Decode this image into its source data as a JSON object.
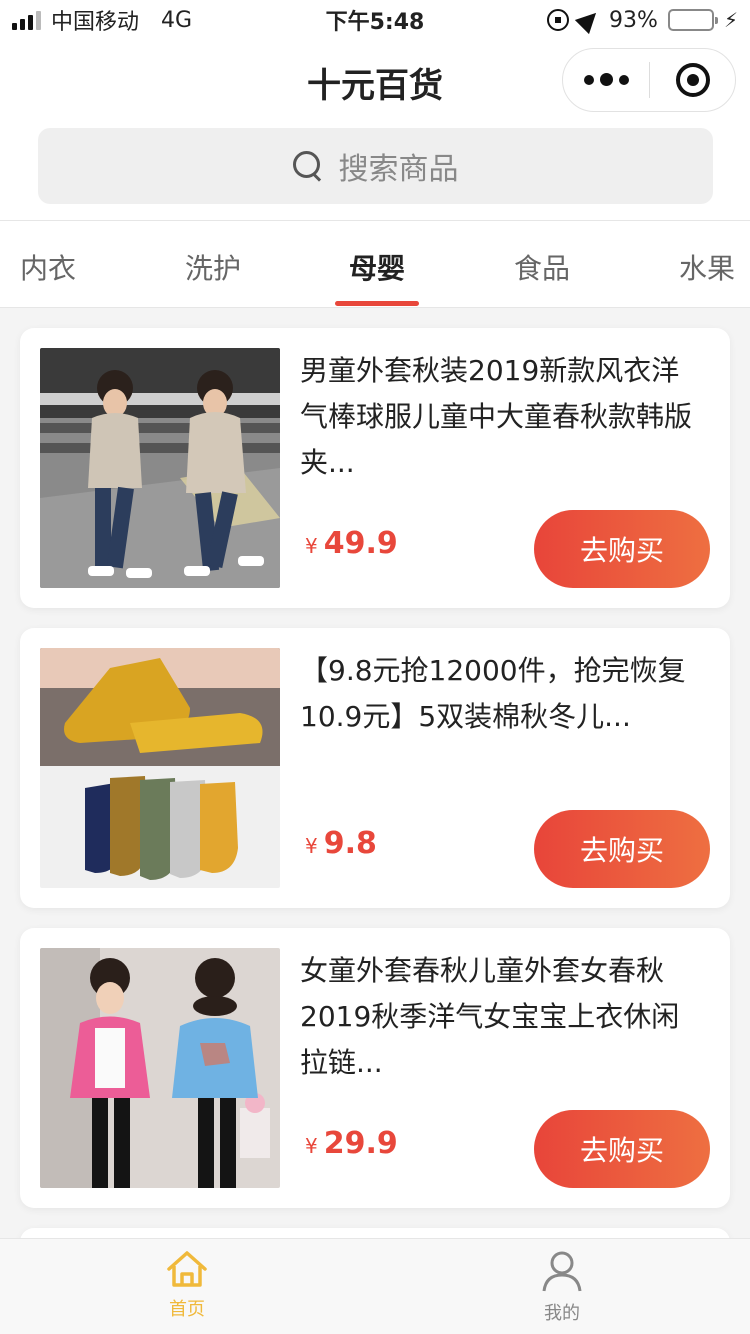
{
  "status_bar": {
    "carrier": "中国移动",
    "network": "4G",
    "time": "下午5:48",
    "battery": "93%",
    "battery_level": 0.93
  },
  "nav": {
    "title": "十元百货"
  },
  "search": {
    "placeholder": "搜索商品"
  },
  "tabs": [
    {
      "label": "内衣"
    },
    {
      "label": "洗护"
    },
    {
      "label": "母婴",
      "active": true
    },
    {
      "label": "食品"
    },
    {
      "label": "水果"
    }
  ],
  "products": [
    {
      "title": "男童外套秋装2019新款风衣洋气棒球服儿童中大童春秋款韩版夹...",
      "currency": "¥",
      "price": "49.9",
      "button": "去购买"
    },
    {
      "title": "【9.8元抢12000件，抢完恢复10.9元】5双装棉秋冬儿...",
      "currency": "¥",
      "price": "9.8",
      "button": "去购买"
    },
    {
      "title": "女童外套春秋儿童外套女春秋2019秋季洋气女宝宝上衣休闲拉链...",
      "currency": "¥",
      "price": "29.9",
      "button": "去购买"
    }
  ],
  "tab_bar": [
    {
      "label": "首页",
      "icon": "home-icon",
      "active": true
    },
    {
      "label": "我的",
      "icon": "person-icon",
      "active": false
    }
  ],
  "colors": {
    "accent": "#e8473b",
    "active_tab_bar": "#f0b93b",
    "inactive_tab_bar": "#888888"
  }
}
